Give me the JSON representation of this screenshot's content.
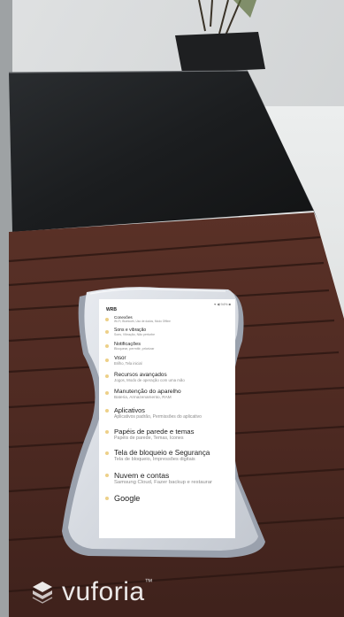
{
  "screen": {
    "title": "WRB",
    "status_text": "▾ ◀ 94% ■",
    "items": [
      {
        "title": "Conexões",
        "subtitle": "Wi-Fi, Bluetooth, Uso de dados, Modo Offline"
      },
      {
        "title": "Sons e vibração",
        "subtitle": "Sons, Vibração, Não perturbe"
      },
      {
        "title": "Notificações",
        "subtitle": "Bloquear, permitir, priorizar"
      },
      {
        "title": "Visor",
        "subtitle": "Brilho, Tela inicial"
      },
      {
        "title": "Recursos avançados",
        "subtitle": "Jogos, Modo de operação com uma mão"
      },
      {
        "title": "Manutenção do aparelho",
        "subtitle": "Bateria, Armazenamento, RAM"
      },
      {
        "title": "Aplicativos",
        "subtitle": "Aplicativos padrão, Permissões do aplicativo"
      },
      {
        "title": "Papéis de parede e temas",
        "subtitle": "Papéis de parede, Temas, Ícones"
      },
      {
        "title": "Tela de bloqueio e Segurança",
        "subtitle": "Tela de bloqueio, Impressões digitais"
      },
      {
        "title": "Nuvem e contas",
        "subtitle": "Samsung Cloud, Fazer backup e restaurar"
      },
      {
        "title": "Google",
        "subtitle": ""
      }
    ]
  },
  "branding": {
    "logo_text": "vuforia",
    "trademark": "™"
  }
}
